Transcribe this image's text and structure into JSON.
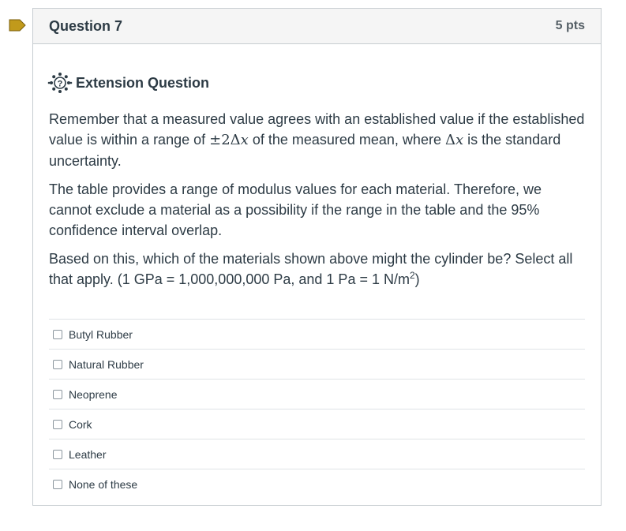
{
  "question": {
    "title": "Question 7",
    "points": "5 pts"
  },
  "extension": {
    "heading": "Extension Question",
    "icon": "gear-question-icon"
  },
  "paragraphs": {
    "p1_a": "Remember that a measured value agrees with an established value if the established value is within a range of ",
    "p1_math": "±2Δ",
    "p1_var": "x",
    "p1_b": " of the measured mean, where ",
    "p1_math2": "Δ",
    "p1_var2": "x",
    "p1_c": " is the standard uncertainty.",
    "p2": "The table provides a range of modulus values for each material. Therefore, we cannot exclude a material as a possibility if the range in the table and the 95% confidence interval overlap.",
    "p3_a": "Based on this, which of the materials shown above might the cylinder be? Select all that apply. (1 GPa = 1,000,000,000 Pa, and 1 Pa = 1 N/m",
    "p3_sup": "2",
    "p3_b": ")"
  },
  "answers": [
    {
      "label": "Butyl Rubber",
      "checked": false
    },
    {
      "label": "Natural Rubber",
      "checked": false
    },
    {
      "label": "Neoprene",
      "checked": false
    },
    {
      "label": "Cork",
      "checked": false
    },
    {
      "label": "Leather",
      "checked": false
    },
    {
      "label": "None of these",
      "checked": false
    }
  ],
  "colors": {
    "flag": "#c19a1b",
    "border": "#c7cdd1",
    "header_bg": "#f5f5f5",
    "text": "#2d3b45"
  }
}
